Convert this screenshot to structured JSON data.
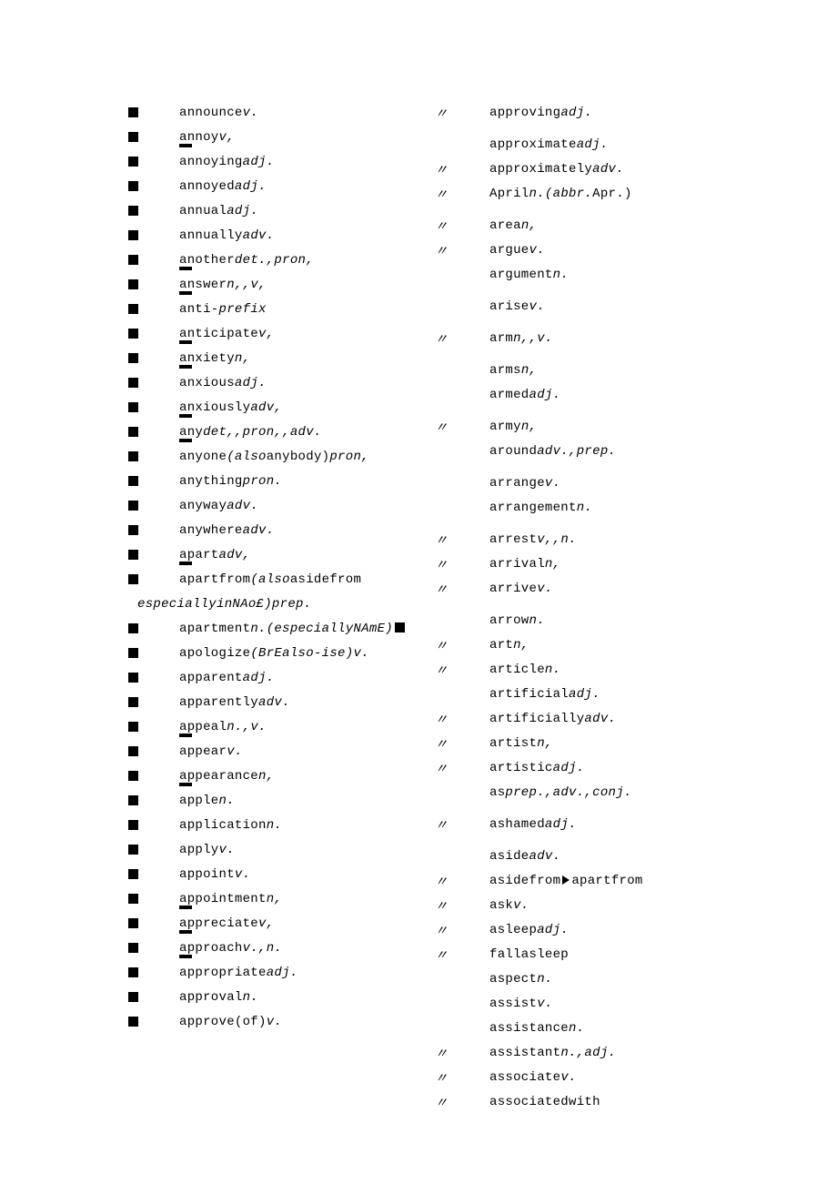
{
  "left": [
    {
      "bullet": true,
      "text": "announce",
      "pos": "v.",
      "lead": "",
      "mark": false
    },
    {
      "bullet": true,
      "text": "annoy",
      "pos": "v,",
      "lead": "",
      "mark": false
    },
    {
      "bullet": true,
      "text": "annoying",
      "pos": "adj.",
      "lead": "",
      "mark": true
    },
    {
      "bullet": true,
      "text": "annoyed",
      "pos": "adj.",
      "lead": "",
      "mark": false
    },
    {
      "bullet": true,
      "text": "annual",
      "pos": "adj.",
      "lead": "",
      "mark": false
    },
    {
      "bullet": true,
      "text": "annually",
      "pos": "adv.",
      "lead": "",
      "mark": false
    },
    {
      "bullet": true,
      "text": "another",
      "pos": "det.,pron,",
      "lead": "",
      "mark": false
    },
    {
      "bullet": true,
      "text": "answer",
      "pos": "n,,v,",
      "lead": "",
      "mark": true
    },
    {
      "bullet": true,
      "text": "anti-",
      "pos": "prefix",
      "lead": "",
      "mark": true
    },
    {
      "bullet": true,
      "text": "anticipate",
      "pos": "v,",
      "lead": "",
      "mark": false
    },
    {
      "bullet": true,
      "text": "anxiety",
      "pos": "n,",
      "lead": "",
      "mark": true
    },
    {
      "bullet": true,
      "text": "anxious",
      "pos": "adj.",
      "lead": "",
      "mark": true
    },
    {
      "bullet": true,
      "text": "anxiously",
      "pos": "adv,",
      "lead": "",
      "mark": false
    },
    {
      "bullet": true,
      "text": "any",
      "pos": "det,,pron,,adv.",
      "lead": "",
      "mark": true
    },
    {
      "bullet": true,
      "text": "anyone",
      "paren": "(also",
      "parenplain": "anybody)",
      "pos": "pron,",
      "lead": "",
      "mark": true
    },
    {
      "bullet": true,
      "text": "anything",
      "pos": "pron.",
      "lead": "",
      "mark": false
    },
    {
      "bullet": true,
      "text": "anyway",
      "pos": "adv.",
      "lead": "",
      "mark": false
    },
    {
      "bullet": true,
      "text": "anywhere",
      "pos": "adv.",
      "lead": "",
      "mark": false
    },
    {
      "bullet": true,
      "text": "apart",
      "pos": "adv,",
      "lead": "",
      "mark": false
    },
    {
      "bullet": true,
      "text": "apartfrom",
      "paren": "(also",
      "parenplain": "asidefrom",
      "pos": "",
      "lead": "",
      "mark": true
    },
    {
      "cont": "especiallyinNAo£)prep."
    },
    {
      "bullet": true,
      "text": "apartment",
      "pos": "n.",
      "paren": "(especiallyNAmE)",
      "trail": "sq",
      "lead": "",
      "mark": false
    },
    {
      "bullet": true,
      "text": "apologize",
      "parenplain": "(BrEalso-ise)",
      "pos": "v.",
      "lead": "",
      "mark": false
    },
    {
      "bullet": true,
      "text": "apparent",
      "pos": "adj.",
      "lead": "",
      "mark": false
    },
    {
      "bullet": true,
      "text": "apparently",
      "pos": "adv.",
      "lead": "",
      "mark": false
    },
    {
      "bullet": true,
      "text": "appeal",
      "pos": "n.,v.",
      "lead": "",
      "mark": false
    },
    {
      "bullet": true,
      "text": "appear",
      "pos": "v.",
      "lead": "",
      "mark": true
    },
    {
      "bullet": true,
      "text": "appearance",
      "pos": "n,",
      "lead": "",
      "mark": false
    },
    {
      "bullet": true,
      "text": "apple",
      "pos": "n.",
      "lead": "",
      "mark": true
    },
    {
      "bullet": true,
      "text": "application",
      "pos": "n.",
      "lead": "",
      "mark": false
    },
    {
      "bullet": true,
      "text": "apply",
      "pos": "v.",
      "lead": "",
      "mark": false
    },
    {
      "bullet": true,
      "text": "appoint",
      "pos": "v.",
      "lead": "",
      "mark": false
    },
    {
      "bullet": true,
      "text": "appointment",
      "pos": "n,",
      "lead": "",
      "mark": false
    },
    {
      "bullet": true,
      "text": "appreciate",
      "pos": "v,",
      "lead": "",
      "mark": true
    },
    {
      "bullet": true,
      "text": "approach",
      "pos": "v.,n.",
      "lead": "",
      "mark": true
    },
    {
      "bullet": true,
      "text": "appropriate",
      "pos": "adj.",
      "lead": "",
      "mark": true
    },
    {
      "bullet": true,
      "text": "approval",
      "pos": "n.",
      "lead": "",
      "mark": false
    },
    {
      "bullet": true,
      "text": "approve(of)",
      "pos": "v.",
      "lead": "",
      "mark": false
    }
  ],
  "right": [
    {
      "ditto": true,
      "text": "approving",
      "pos": "adj.",
      "mark": false
    },
    {
      "text": "approximate",
      "pos": "adj.",
      "mark": false,
      "gap": true
    },
    {
      "ditto": true,
      "text": "approximately",
      "pos": "adv.",
      "mark": false
    },
    {
      "ditto": true,
      "text": "April",
      "pos": "n.",
      "paren": "(abbr.",
      "parenplain": "Apr.)",
      "mark": false
    },
    {
      "ditto": true,
      "text": "area",
      "pos": "n,",
      "mark": false,
      "gap": true
    },
    {
      "ditto": true,
      "text": "argue",
      "pos": "v.",
      "mark": false
    },
    {
      "text": "argument",
      "pos": "n.",
      "mark": false
    },
    {
      "text": "arise",
      "pos": "v.",
      "mark": false,
      "gap": true
    },
    {
      "ditto": true,
      "text": "arm",
      "pos": "n,,v.",
      "mark": false,
      "gap": true
    },
    {
      "text": "arms",
      "pos": "n,",
      "mark": false,
      "gap": true
    },
    {
      "text": "armed",
      "pos": "adj.",
      "mark": false
    },
    {
      "ditto": true,
      "text": "army",
      "pos": "n,",
      "mark": false,
      "gap": true
    },
    {
      "text": "around",
      "pos": "adv.,prep.",
      "mark": false
    },
    {
      "text": "arrange",
      "pos": "v.",
      "mark": false,
      "gap": true
    },
    {
      "text": "arrangement",
      "pos": "n.",
      "mark": false
    },
    {
      "ditto": true,
      "text": "arrest",
      "pos": "v,,n.",
      "mark": false,
      "gap": true
    },
    {
      "ditto": true,
      "text": "arrival",
      "pos": "n,",
      "mark": false
    },
    {
      "ditto": true,
      "text": "arrive",
      "pos": "v.",
      "mark": false
    },
    {
      "text": "arrow",
      "pos": "n.",
      "mark": false,
      "gap": true
    },
    {
      "ditto": true,
      "text": "art",
      "pos": "n,",
      "mark": false
    },
    {
      "ditto": true,
      "text": "article",
      "pos": "n.",
      "mark": false
    },
    {
      "text": "artificial",
      "pos": "adj.",
      "mark": false
    },
    {
      "ditto": true,
      "text": "artificially",
      "pos": "adv.",
      "mark": false
    },
    {
      "ditto": true,
      "text": "artist",
      "pos": "n,",
      "mark": false
    },
    {
      "ditto": true,
      "text": "artistic",
      "pos": "adj.",
      "mark": false
    },
    {
      "text": "as",
      "pos": "prep.,adv.,conj.",
      "mark": false
    },
    {
      "ditto": true,
      "text": "ashamed",
      "pos": "adj.",
      "mark": false,
      "gap": true
    },
    {
      "text": "aside",
      "pos": "adv.",
      "mark": false,
      "gap": true
    },
    {
      "ditto": true,
      "text": "asidefrom",
      "trail": "tri",
      "trailtext": "apartfrom",
      "mark": false
    },
    {
      "ditto": true,
      "text": "ask",
      "pos": "v.",
      "mark": false
    },
    {
      "ditto": true,
      "text": "asleep",
      "pos": "adj.",
      "mark": false
    },
    {
      "ditto": true,
      "text": "fallasleep",
      "mark": false
    },
    {
      "text": "aspect",
      "pos": "n.",
      "mark": false
    },
    {
      "text": "assist",
      "pos": "v.",
      "mark": false
    },
    {
      "text": "assistance",
      "pos": "n.",
      "mark": false
    },
    {
      "ditto": true,
      "text": "assistant",
      "pos": "n.,adj.",
      "mark": false
    },
    {
      "ditto": true,
      "text": "associate",
      "pos": "v.",
      "mark": false
    },
    {
      "ditto": true,
      "text": "associatedwith",
      "mark": false
    }
  ]
}
